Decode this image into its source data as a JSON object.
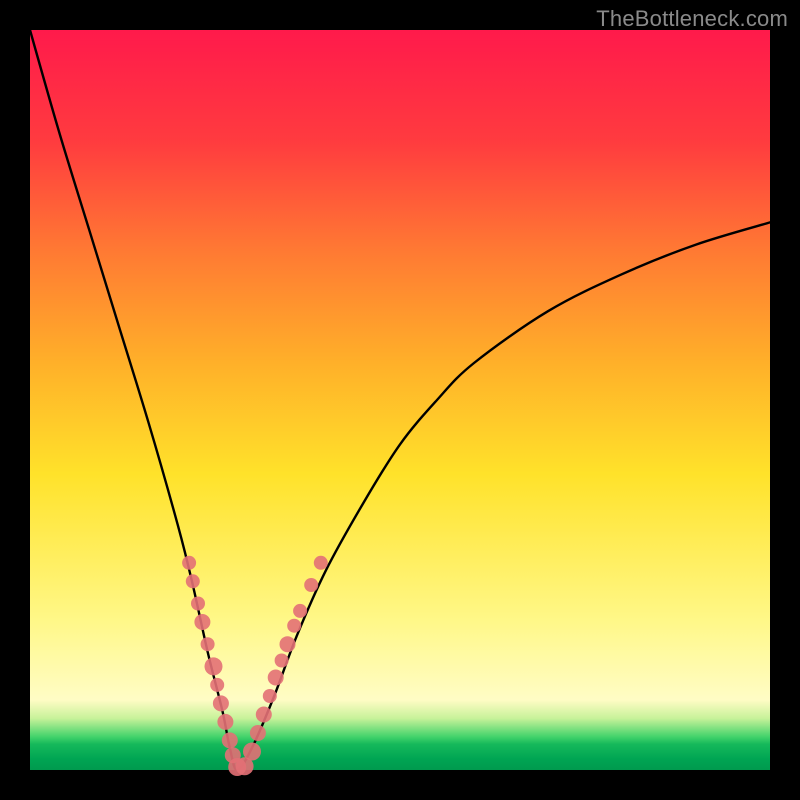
{
  "watermark": "TheBottleneck.com",
  "chart_data": {
    "type": "line",
    "title": "",
    "xlabel": "",
    "ylabel": "",
    "xlim": [
      0,
      100
    ],
    "ylim": [
      0,
      100
    ],
    "grid": false,
    "legend": false,
    "background_gradient": {
      "stops": [
        {
          "pos": 0.0,
          "color": "#ff1a4b"
        },
        {
          "pos": 0.15,
          "color": "#ff3b3f"
        },
        {
          "pos": 0.3,
          "color": "#ff7a33"
        },
        {
          "pos": 0.45,
          "color": "#ffb029"
        },
        {
          "pos": 0.6,
          "color": "#ffe22a"
        },
        {
          "pos": 0.8,
          "color": "#fff889"
        },
        {
          "pos": 0.905,
          "color": "#fffcc5"
        },
        {
          "pos": 0.93,
          "color": "#c8f29a"
        },
        {
          "pos": 0.955,
          "color": "#43d36b"
        },
        {
          "pos": 0.965,
          "color": "#16b95b"
        },
        {
          "pos": 0.985,
          "color": "#00a553"
        },
        {
          "pos": 1.0,
          "color": "#009a4e"
        }
      ]
    },
    "series": [
      {
        "name": "bottleneck-curve",
        "x": [
          0,
          4,
          8,
          12,
          16,
          20,
          22,
          24,
          26,
          27,
          28,
          30,
          33,
          36,
          40,
          45,
          50,
          55,
          60,
          70,
          80,
          90,
          100
        ],
        "y": [
          100,
          86,
          73,
          60,
          47,
          33,
          25,
          16,
          8,
          3,
          0,
          3,
          10,
          18,
          27,
          36,
          44,
          50,
          55,
          62,
          67,
          71,
          74
        ]
      }
    ],
    "markers": [
      {
        "x": 21.5,
        "y": 28.0,
        "r": 7
      },
      {
        "x": 22.0,
        "y": 25.5,
        "r": 7
      },
      {
        "x": 22.7,
        "y": 22.5,
        "r": 7
      },
      {
        "x": 23.3,
        "y": 20.0,
        "r": 8
      },
      {
        "x": 24.0,
        "y": 17.0,
        "r": 7
      },
      {
        "x": 24.8,
        "y": 14.0,
        "r": 9
      },
      {
        "x": 25.3,
        "y": 11.5,
        "r": 7
      },
      {
        "x": 25.8,
        "y": 9.0,
        "r": 8
      },
      {
        "x": 26.4,
        "y": 6.5,
        "r": 8
      },
      {
        "x": 27.0,
        "y": 4.0,
        "r": 8
      },
      {
        "x": 27.4,
        "y": 2.0,
        "r": 8
      },
      {
        "x": 28.0,
        "y": 0.4,
        "r": 9
      },
      {
        "x": 29.0,
        "y": 0.5,
        "r": 9
      },
      {
        "x": 30.0,
        "y": 2.5,
        "r": 9
      },
      {
        "x": 30.8,
        "y": 5.0,
        "r": 8
      },
      {
        "x": 31.6,
        "y": 7.5,
        "r": 8
      },
      {
        "x": 32.4,
        "y": 10.0,
        "r": 7
      },
      {
        "x": 33.2,
        "y": 12.5,
        "r": 8
      },
      {
        "x": 34.0,
        "y": 14.8,
        "r": 7
      },
      {
        "x": 34.8,
        "y": 17.0,
        "r": 8
      },
      {
        "x": 35.7,
        "y": 19.5,
        "r": 7
      },
      {
        "x": 36.5,
        "y": 21.5,
        "r": 7
      },
      {
        "x": 38.0,
        "y": 25.0,
        "r": 7
      },
      {
        "x": 39.3,
        "y": 28.0,
        "r": 7
      }
    ],
    "marker_style": {
      "fill": "#e37076",
      "opacity": 0.9
    }
  }
}
